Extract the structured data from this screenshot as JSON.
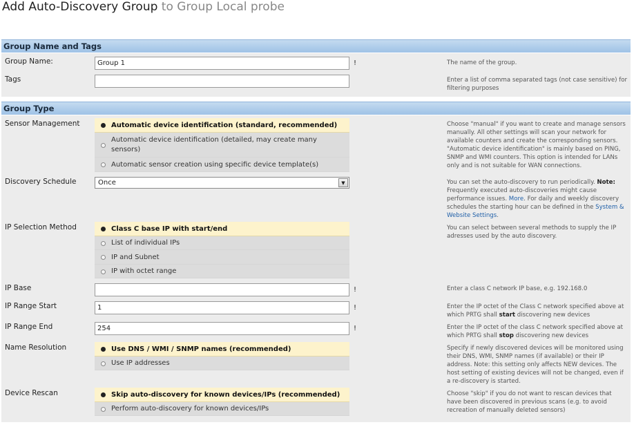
{
  "header": {
    "title_main": "Add Auto-Discovery Group",
    "title_sub": "to Group Local probe"
  },
  "sections": {
    "group_name_tags": "Group Name and Tags",
    "group_type": "Group Type"
  },
  "fields": {
    "group_name": {
      "label": "Group Name:",
      "value": "Group 1",
      "required": "!",
      "help": "The name of the group."
    },
    "tags": {
      "label": "Tags",
      "value": "",
      "help": "Enter a list of comma separated tags (not case sensitive) for filtering purposes"
    },
    "sensor_management": {
      "label": "Sensor Management",
      "options": [
        "Automatic device identification (standard, recommended)",
        "Automatic device identification (detailed, may create many sensors)",
        "Automatic sensor creation using specific device template(s)"
      ],
      "selected": 0,
      "help": "Choose \"manual\" if you want to create and manage sensors manually. All other settings will scan your network for available counters and create the corresponding sensors. \"Automatic device identification\" is mainly based on PING, SNMP and WMI counters. This option is intended for LANs only and is not suitable for WAN connections."
    },
    "discovery_schedule": {
      "label": "Discovery Schedule",
      "value": "Once",
      "help_1": "You can set the auto-discovery to run periodically.",
      "help_note": "Note:",
      "help_2": "Frequently executed auto-discoveries might cause performance issues.",
      "help_more": "More",
      "help_3": ". For daily and weekly discovery schedules the starting hour can be defined in the",
      "help_link": "System & Website Settings",
      "help_end": "."
    },
    "ip_selection_method": {
      "label": "IP Selection Method",
      "options": [
        "Class C base IP with start/end",
        "List of individual IPs",
        "IP and Subnet",
        "IP with octet range"
      ],
      "selected": 0,
      "help": "You can select between several methods to supply the IP adresses used by the auto discovery."
    },
    "ip_base": {
      "label": "IP Base",
      "value": "",
      "required": "!",
      "help": "Enter a class C network IP base, e.g. 192.168.0"
    },
    "ip_range_start": {
      "label": "IP Range Start",
      "value": "1",
      "required": "!",
      "help_1": "Enter the IP octet of the Class C network specified above at which PRTG shall",
      "help_bold": "start",
      "help_2": "discovering new devices"
    },
    "ip_range_end": {
      "label": "IP Range End",
      "value": "254",
      "required": "!",
      "help_1": "Enter the IP octet of the class C network specified above at which PRTG shall",
      "help_bold": "stop",
      "help_2": "discovering new devices"
    },
    "name_resolution": {
      "label": "Name Resolution",
      "options": [
        "Use DNS / WMI / SNMP names (recommended)",
        "Use IP addresses"
      ],
      "selected": 0,
      "help": "Specify if newly discovered devices will be monitored using their DNS, WMI, SNMP names (if available) or their IP address. Note: this setting only affects NEW devices. The host setting of existing devices will not be changed, even if a re-discovery is started."
    },
    "device_rescan": {
      "label": "Device Rescan",
      "options": [
        "Skip auto-discovery for known devices/IPs (recommended)",
        "Perform auto-discovery for known devices/IPs"
      ],
      "selected": 0,
      "help": "Choose \"skip\" if you do not want to rescan devices that have been discovered in previous scans (e.g. to avoid recreation of manually deleted sensors)"
    }
  },
  "icons": {
    "dropdown": "chevron-down-icon"
  },
  "colors": {
    "section_header": "#b3cfec",
    "band": "#ececec",
    "selected_option": "#fdf3cc",
    "link": "#1f5fa8"
  }
}
